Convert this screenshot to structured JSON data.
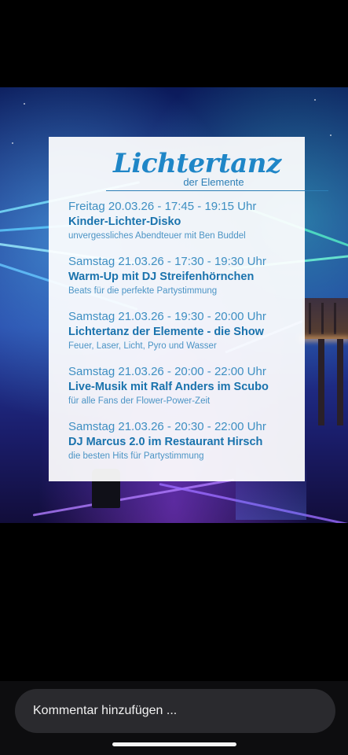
{
  "poster": {
    "logo_title": "Lichtertanz",
    "logo_subtitle": "der Elemente",
    "events": [
      {
        "datetime": "Freitag 20.03.26 - 17:45 - 19:15 Uhr",
        "title": "Kinder-Lichter-Disko",
        "description": "unvergessliches Abendteuer mit Ben Buddel"
      },
      {
        "datetime": "Samstag 21.03.26 - 17:30 - 19:30 Uhr",
        "title": "Warm-Up mit DJ Streifenhörnchen",
        "description": "Beats für die perfekte Partystimmung"
      },
      {
        "datetime": "Samstag 21.03.26 - 19:30 - 20:00 Uhr",
        "title": "Lichtertanz der Elemente - die Show",
        "description": "Feuer, Laser, Licht, Pyro und Wasser"
      },
      {
        "datetime": "Samstag 21.03.26 - 20:00 - 22:00 Uhr",
        "title": "Live-Musik mit Ralf Anders im Scubo",
        "description": "für alle Fans der Flower-Power-Zeit"
      },
      {
        "datetime": "Samstag 21.03.26 - 20:30 - 22:00 Uhr",
        "title": "DJ Marcus 2.0 im Restaurant Hirsch",
        "description": "die besten Hits für Partystimmung"
      }
    ]
  },
  "comment": {
    "placeholder": "Kommentar hinzufügen ..."
  },
  "colors": {
    "accent_blue": "#1f86c7",
    "background": "#000000",
    "comment_field": "#2a2a2e"
  }
}
